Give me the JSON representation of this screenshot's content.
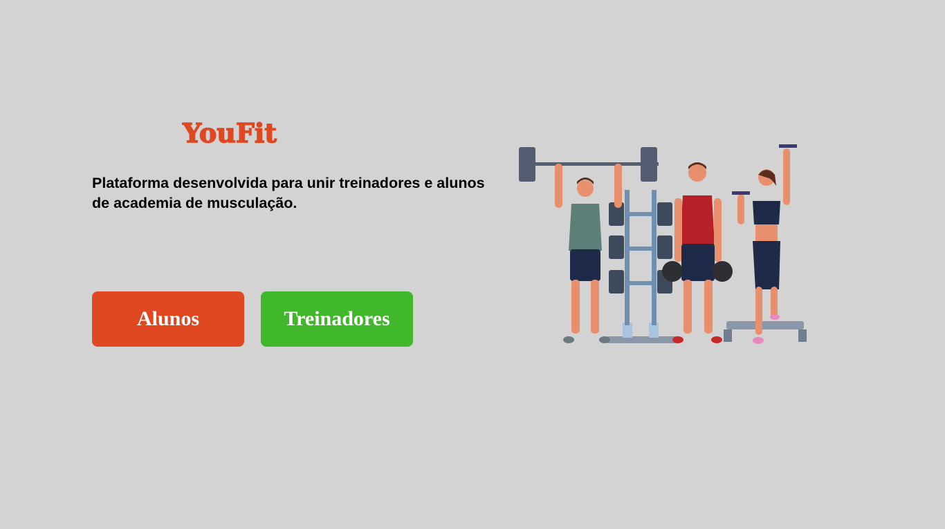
{
  "brand": {
    "name": "YouFit",
    "color": "#e04822"
  },
  "hero": {
    "tagline": "Plataforma desenvolvida para unir treinadores e alunos de academia de musculação."
  },
  "actions": {
    "alunos_label": "Alunos",
    "alunos_color": "#e04822",
    "treinadores_label": "Treinadores",
    "treinadores_color": "#41b82b"
  },
  "illustration": {
    "icon": "gym-people-illustration"
  }
}
